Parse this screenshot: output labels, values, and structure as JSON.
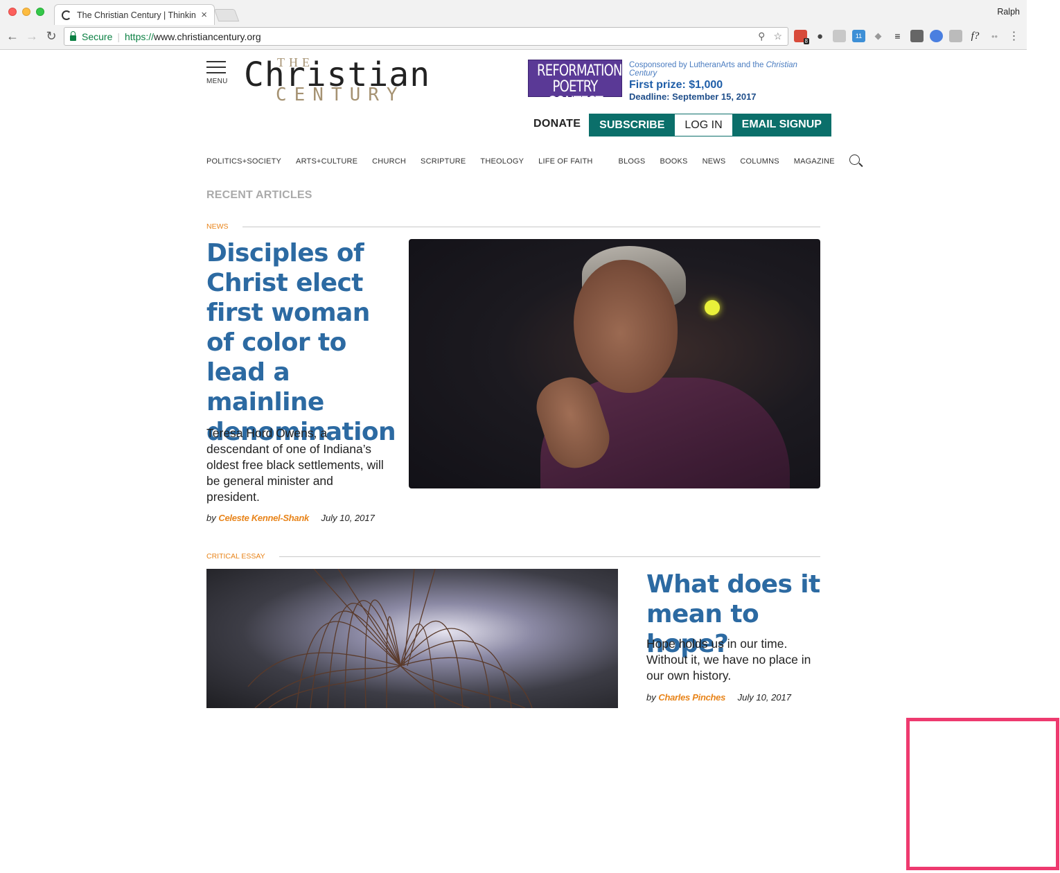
{
  "browser": {
    "tab_title": "The Christian Century | Thinkin",
    "profile": "Ralph",
    "secure_label": "Secure",
    "url_scheme": "https://",
    "url_host": "www.christiancentury.org",
    "extension_badge": "8",
    "calendar_badge": "11",
    "extension_f": "f?"
  },
  "site": {
    "menu_label": "MENU",
    "logo": {
      "the": "THE",
      "christian": "Christian",
      "century": "CENTURY"
    },
    "ad": {
      "line1": "REFORMATION",
      "line2": "POETRY CONTEST",
      "cosponsor": "Cosponsored by LutheranArts and the",
      "cosponsor_em": "Christian Century",
      "prize": "First prize: $1,000",
      "deadline": "Deadline: September 15, 2017"
    },
    "utility": {
      "donate": "DONATE",
      "subscribe": "SUBSCRIBE",
      "login": "LOG IN",
      "email_signup": "EMAIL SIGNUP"
    },
    "nav_primary": [
      "POLITICS+SOCIETY",
      "ARTS+CULTURE",
      "CHURCH",
      "SCRIPTURE",
      "THEOLOGY",
      "LIFE OF FAITH"
    ],
    "nav_secondary": [
      "BLOGS",
      "BOOKS",
      "NEWS",
      "COLUMNS",
      "MAGAZINE"
    ]
  },
  "recent_label": "RECENT ARTICLES",
  "articles": [
    {
      "category": "NEWS",
      "headline": "Disciples of Christ elect first woman of color to lead a mainline denomination",
      "dek": "Teresa Hord Owens, a descendant of one of Indiana’s oldest free black settlements, will be general minister and president.",
      "by": "by",
      "author": "Celeste Kennel-Shank",
      "date": "July 10, 2017"
    },
    {
      "category": "CRITICAL ESSAY",
      "headline": "What does it mean to hope?",
      "dek": "Hope holds us in our time. Without it, we have no place in our own history.",
      "by": "by",
      "author": "Charles Pinches",
      "date": "July 10, 2017"
    }
  ],
  "colors": {
    "accent_teal": "#0b6f6a",
    "headline_blue": "#2c6aa2",
    "category_orange": "#e8841a",
    "ad_purple": "#5a3996",
    "annotation_pink": "#ee3a6f"
  }
}
